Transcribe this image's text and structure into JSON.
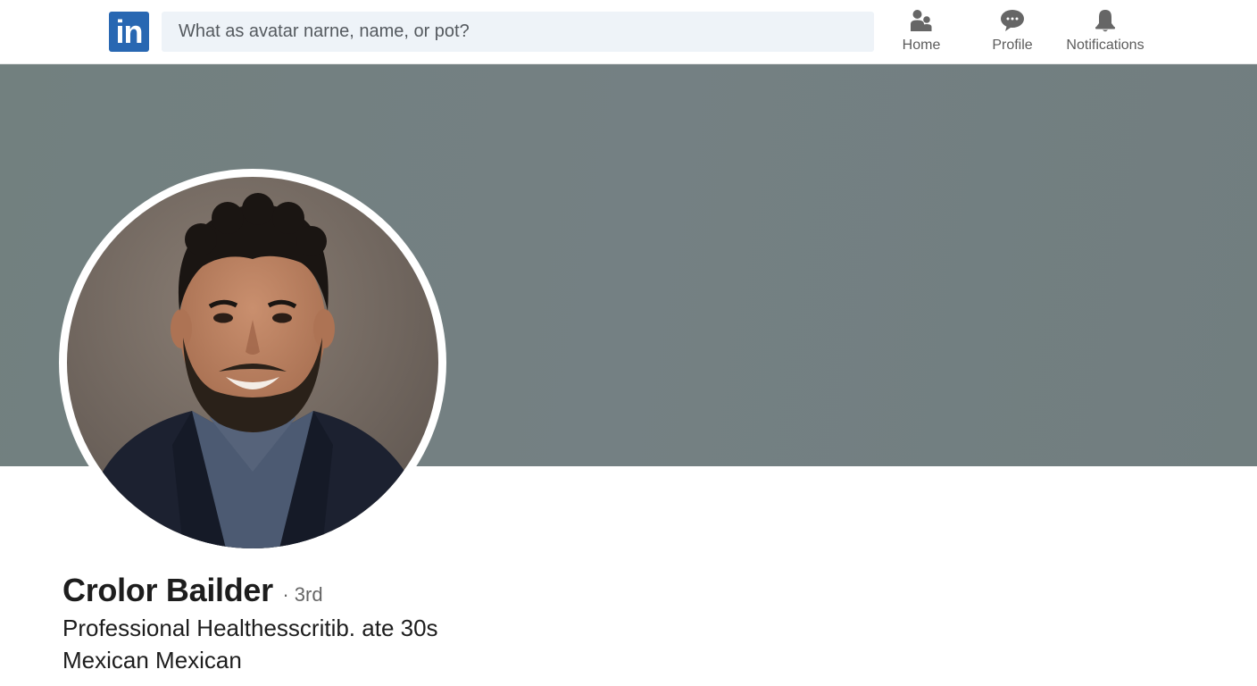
{
  "nav": {
    "logo_text": "in",
    "search": {
      "placeholder": "What as avatar narne, name, or pot?",
      "value": ""
    },
    "items": [
      {
        "label": "Home",
        "icon": "people-icon"
      },
      {
        "label": "Profile",
        "icon": "chat-bubble-icon"
      },
      {
        "label": "Notifications",
        "icon": "bell-icon"
      }
    ]
  },
  "profile": {
    "name": "Crolor Bailder",
    "degree": "· 3rd",
    "headline": "Professional Healthesscritib. ate 30s",
    "location": "Mexican Mexican",
    "avatar": "profile-photo"
  },
  "colors": {
    "brand": "#2867b2",
    "cover": "#737f81",
    "search_bg": "#eef3f8",
    "nav_icon": "#666666"
  }
}
